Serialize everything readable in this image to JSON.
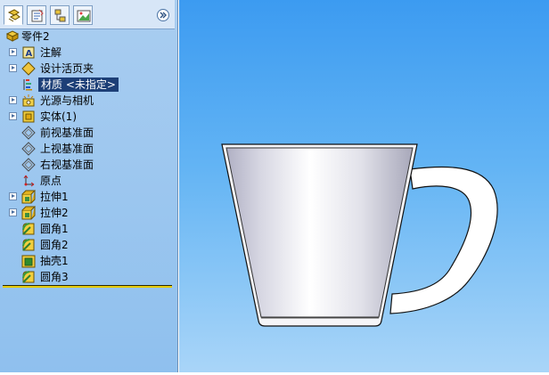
{
  "panel": {
    "tabs": [
      {
        "name": "feature-manager",
        "icon": "feature-tree-icon"
      },
      {
        "name": "property-manager",
        "icon": "property-icon"
      },
      {
        "name": "configuration-manager",
        "icon": "configuration-icon"
      },
      {
        "name": "display-manager",
        "icon": "display-icon"
      }
    ],
    "collapse_icon": "double-chevron-right-icon"
  },
  "tree": {
    "root": {
      "label": "零件2",
      "icon": "part-icon"
    },
    "items": [
      {
        "label": "注解",
        "icon": "annotation-icon",
        "expandable": true
      },
      {
        "label": "设计活页夹",
        "icon": "design-binder-icon",
        "expandable": true
      },
      {
        "label": "材质 <未指定>",
        "icon": "material-icon",
        "expandable": false,
        "selected": true
      },
      {
        "label": "光源与相机",
        "icon": "lights-camera-icon",
        "expandable": true
      },
      {
        "label": "实体(1)",
        "icon": "solid-body-icon",
        "expandable": true
      },
      {
        "label": "前视基准面",
        "icon": "plane-icon",
        "expandable": false
      },
      {
        "label": "上视基准面",
        "icon": "plane-icon",
        "expandable": false
      },
      {
        "label": "右视基准面",
        "icon": "plane-icon",
        "expandable": false
      },
      {
        "label": "原点",
        "icon": "origin-icon",
        "expandable": false
      },
      {
        "label": "拉伸1",
        "icon": "extrude-icon",
        "expandable": true
      },
      {
        "label": "拉伸2",
        "icon": "extrude-icon",
        "expandable": true
      },
      {
        "label": "圆角1",
        "icon": "fillet-icon",
        "expandable": false
      },
      {
        "label": "圆角2",
        "icon": "fillet-icon",
        "expandable": false
      },
      {
        "label": "抽壳1",
        "icon": "shell-icon",
        "expandable": false
      },
      {
        "label": "圆角3",
        "icon": "fillet-icon",
        "expandable": false
      }
    ]
  },
  "viewport": {
    "model": "cup-model",
    "background_top": "#3c9bf1",
    "background_bottom": "#a9d5f8"
  }
}
